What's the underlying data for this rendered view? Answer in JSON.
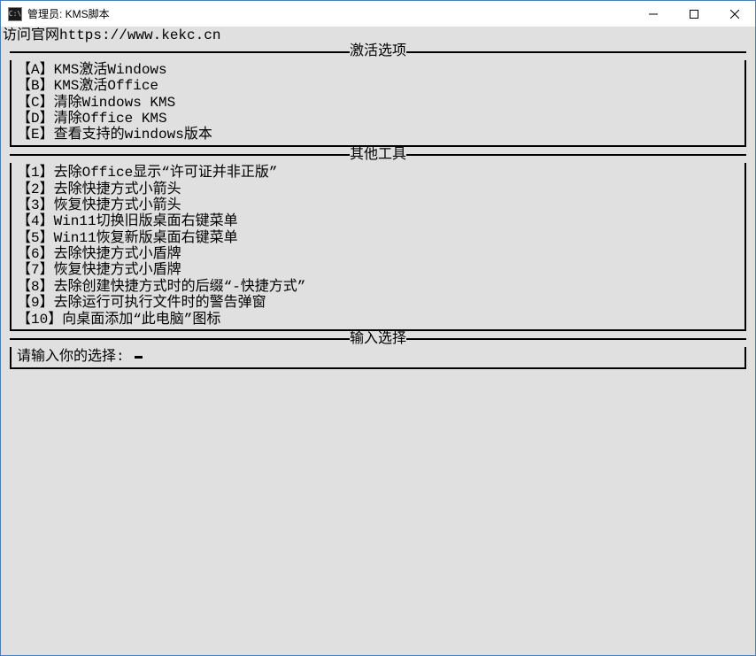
{
  "titlebar": {
    "icon_label": "C:\\",
    "title": "管理员: KMS脚本"
  },
  "top_line": "访问官网https://www.kekc.cn",
  "sections": {
    "activation": {
      "title": "激活选项",
      "items": [
        "【A】KMS激活Windows",
        "【B】KMS激活Office",
        "【C】清除Windows KMS",
        "【D】清除Office KMS",
        "【E】查看支持的windows版本"
      ]
    },
    "tools": {
      "title": "其他工具",
      "items": [
        "【1】去除Office显示“许可证并非正版”",
        "【2】去除快捷方式小箭头",
        "【3】恢复快捷方式小箭头",
        "【4】Win11切换旧版桌面右键菜单",
        "【5】Win11恢复新版桌面右键菜单",
        "【6】去除快捷方式小盾牌",
        "【7】恢复快捷方式小盾牌",
        "【8】去除创建快捷方式时的后缀“-快捷方式”",
        "【9】去除运行可执行文件时的警告弹窗",
        "【10】向桌面添加“此电脑”图标"
      ]
    },
    "input": {
      "title": "输入选择",
      "prompt": "请输入你的选择: "
    }
  }
}
